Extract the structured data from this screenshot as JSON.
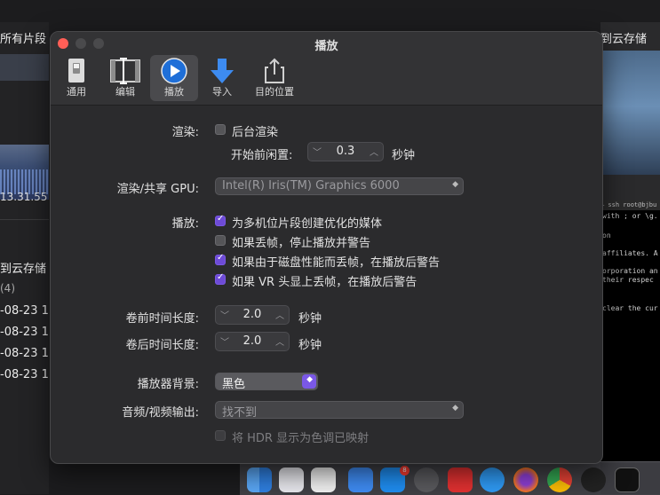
{
  "background": {
    "left_title": "所有片段",
    "left_timestamp": "13.31.55",
    "left_group": "到云存储",
    "left_count": "(4)",
    "left_rows": [
      "-08-23 1",
      "-08-23 1",
      "-08-23 1",
      "-08-23 1"
    ],
    "right_title": "到云存储",
    "terminal_header": "— ssh root@bjbu",
    "terminal_lines": [
      "with ; or \\g.",
      "on",
      "affiliates. A",
      "orporation an",
      "their respec",
      "clear the cur"
    ]
  },
  "window": {
    "title": "播放",
    "tabs": [
      {
        "label": "通用",
        "icon": "general-switch-icon"
      },
      {
        "label": "编辑",
        "icon": "film-edit-icon"
      },
      {
        "label": "播放",
        "icon": "play-icon"
      },
      {
        "label": "导入",
        "icon": "import-arrow-icon"
      },
      {
        "label": "目的位置",
        "icon": "share-icon"
      }
    ],
    "active_tab": "播放"
  },
  "render": {
    "label": "渲染:",
    "background_render": {
      "label": "后台渲染",
      "checked": false
    },
    "idle_label": "开始前闲置:",
    "idle_value": "0.3",
    "idle_unit": "秒钟"
  },
  "gpu": {
    "label": "渲染/共享 GPU:",
    "value": "Intel(R) Iris(TM) Graphics 6000"
  },
  "playback": {
    "label": "播放:",
    "options": [
      {
        "label": "为多机位片段创建优化的媒体",
        "checked": true
      },
      {
        "label": "如果丢帧，停止播放并警告",
        "checked": false
      },
      {
        "label": "如果由于磁盘性能而丢帧，在播放后警告",
        "checked": true
      },
      {
        "label": "如果 VR 头显上丢帧，在播放后警告",
        "checked": true
      }
    ]
  },
  "preroll": {
    "label": "卷前时间长度:",
    "value": "2.0",
    "unit": "秒钟"
  },
  "postroll": {
    "label": "卷后时间长度:",
    "value": "2.0",
    "unit": "秒钟"
  },
  "player_background": {
    "label": "播放器背景:",
    "value": "黑色"
  },
  "av_output": {
    "label": "音频/视频输出:",
    "value": "找不到"
  },
  "hdr": {
    "label": "将 HDR 显示为色调已映射",
    "checked": false,
    "enabled": false
  },
  "dock": {
    "badge": "8"
  },
  "colors": {
    "accent": "#7a58e6",
    "window_bg": "#2b2b2d",
    "close": "#ff5f57"
  }
}
